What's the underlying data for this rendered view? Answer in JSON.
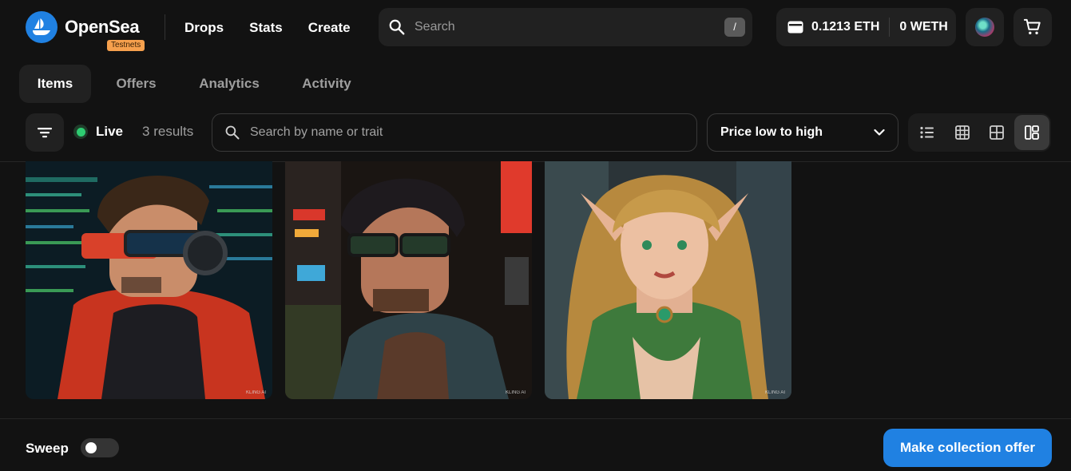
{
  "header": {
    "brand": "OpenSea",
    "network_badge": "Testnets",
    "nav": [
      {
        "label": "Drops"
      },
      {
        "label": "Stats"
      },
      {
        "label": "Create"
      }
    ],
    "search": {
      "placeholder": "Search",
      "shortcut": "/"
    },
    "wallet": {
      "eth_balance": "0.1213 ETH",
      "weth_balance": "0 WETH"
    },
    "icons": {
      "logo": "opensea-boat-icon",
      "search": "search-icon",
      "wallet": "wallet-icon",
      "avatar": "avatar",
      "cart": "cart-icon"
    }
  },
  "tabs": [
    {
      "label": "Items",
      "active": true
    },
    {
      "label": "Offers",
      "active": false
    },
    {
      "label": "Analytics",
      "active": false
    },
    {
      "label": "Activity",
      "active": false
    }
  ],
  "toolbar": {
    "status": "Live",
    "results": "3 results",
    "trait_search_placeholder": "Search by name or trait",
    "sort_selected": "Price low to high",
    "view_modes": [
      {
        "icon": "list-view-icon",
        "active": false
      },
      {
        "icon": "small-grid-icon",
        "active": false
      },
      {
        "icon": "large-grid-icon",
        "active": false
      },
      {
        "icon": "mosaic-view-icon",
        "active": true
      }
    ],
    "colors": {
      "live": "#2ecc71"
    }
  },
  "items": [
    {
      "image": "pixel-art-man-red-hoodie-headphones-glasses",
      "watermark": "KLING AI"
    },
    {
      "image": "pixel-art-man-glasses-city-night",
      "watermark": "KLING AI"
    },
    {
      "image": "pixel-art-elf-woman-green-dress",
      "watermark": "KLING AI"
    }
  ],
  "footer": {
    "sweep_label": "Sweep",
    "sweep_enabled": false,
    "offer_button": "Make collection offer"
  },
  "colors": {
    "accent": "#2081e2",
    "background": "#121212",
    "surface": "#212121",
    "badge": "#f6a04d"
  }
}
